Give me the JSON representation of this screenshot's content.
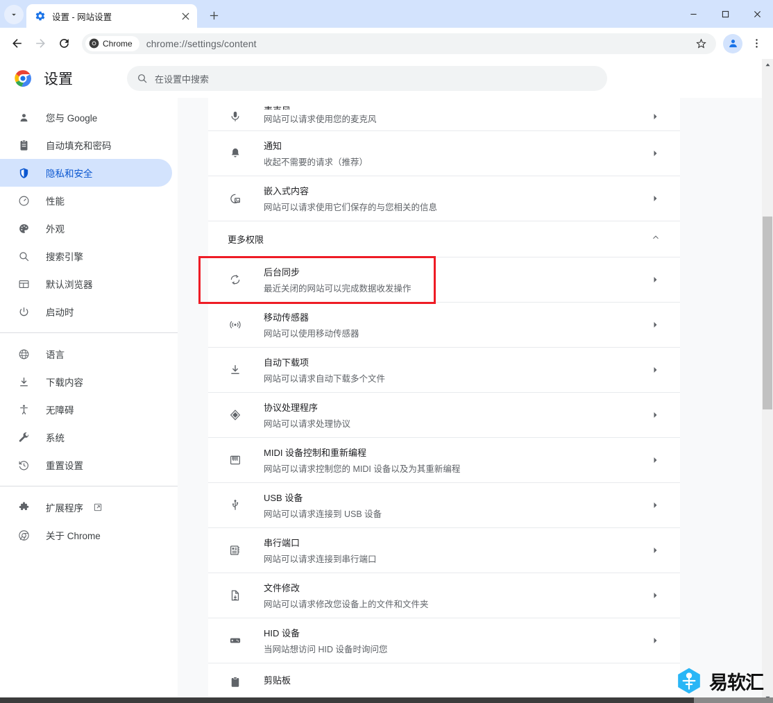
{
  "window": {
    "tab": {
      "title": "设置 - 网站设置",
      "favicon": "gear-icon",
      "close": "×"
    },
    "new_tab": "+",
    "tab_search": "chevron-down-icon",
    "controls": {
      "minimize": "—",
      "maximize": "□",
      "close": "✕"
    }
  },
  "toolbar": {
    "back": "back-arrow-icon",
    "forward": "forward-arrow-icon",
    "reload": "reload-icon",
    "chip_label": "Chrome",
    "url": "chrome://settings/content",
    "bookmark": "star-icon",
    "profile": "avatar-icon",
    "menu": "three-dot-menu-icon"
  },
  "settings": {
    "title": "设置",
    "search_placeholder": "在设置中搜索"
  },
  "sidebar": {
    "groups": [
      {
        "items": [
          {
            "icon": "person-icon",
            "label": "您与 Google",
            "active": false
          },
          {
            "icon": "clipboard-icon",
            "label": "自动填充和密码",
            "active": false
          },
          {
            "icon": "shield-icon",
            "label": "隐私和安全",
            "active": true
          },
          {
            "icon": "gauge-icon",
            "label": "性能",
            "active": false
          },
          {
            "icon": "palette-icon",
            "label": "外观",
            "active": false
          },
          {
            "icon": "search-icon",
            "label": "搜索引擎",
            "active": false
          },
          {
            "icon": "browser-window-icon",
            "label": "默认浏览器",
            "active": false
          },
          {
            "icon": "power-icon",
            "label": "启动时",
            "active": false
          }
        ]
      },
      {
        "items": [
          {
            "icon": "globe-icon",
            "label": "语言",
            "active": false
          },
          {
            "icon": "download-icon",
            "label": "下载内容",
            "active": false
          },
          {
            "icon": "accessibility-icon",
            "label": "无障碍",
            "active": false
          },
          {
            "icon": "wrench-icon",
            "label": "系统",
            "active": false
          },
          {
            "icon": "history-restore-icon",
            "label": "重置设置",
            "active": false
          }
        ]
      },
      {
        "items": [
          {
            "icon": "puzzle-icon",
            "label": "扩展程序",
            "active": false,
            "external": true
          },
          {
            "icon": "chrome-icon",
            "label": "关于 Chrome",
            "active": false
          }
        ]
      }
    ]
  },
  "content": {
    "rows_before_section": [
      {
        "icon": "microphone-icon",
        "title": "麦克风",
        "subtitle": "网站可以请求使用您的麦克风",
        "clipped_top": true
      },
      {
        "icon": "bell-icon",
        "title": "通知",
        "subtitle": "收起不需要的请求（推荐）"
      },
      {
        "icon": "embedded-content-icon",
        "title": "嵌入式内容",
        "subtitle": "网站可以请求使用它们保存的与您相关的信息"
      }
    ],
    "section": {
      "label": "更多权限",
      "expanded": true,
      "collapse_icon": "chevron-up-icon"
    },
    "rows_after_section": [
      {
        "icon": "sync-icon",
        "title": "后台同步",
        "subtitle": "最近关闭的网站可以完成数据收发操作",
        "highlighted": true
      },
      {
        "icon": "motion-sensor-icon",
        "title": "移动传感器",
        "subtitle": "网站可以使用移动传感器"
      },
      {
        "icon": "download-icon",
        "title": "自动下载项",
        "subtitle": "网站可以请求自动下载多个文件"
      },
      {
        "icon": "protocol-handler-icon",
        "title": "协议处理程序",
        "subtitle": "网站可以请求处理协议"
      },
      {
        "icon": "midi-icon",
        "title": "MIDI 设备控制和重新编程",
        "subtitle": "网站可以请求控制您的 MIDI 设备以及为其重新编程"
      },
      {
        "icon": "usb-icon",
        "title": "USB 设备",
        "subtitle": "网站可以请求连接到 USB 设备"
      },
      {
        "icon": "serial-port-icon",
        "title": "串行端口",
        "subtitle": "网站可以请求连接到串行端口"
      },
      {
        "icon": "file-edit-icon",
        "title": "文件修改",
        "subtitle": "网站可以请求修改您设备上的文件和文件夹"
      },
      {
        "icon": "hid-device-icon",
        "title": "HID 设备",
        "subtitle": "当网站想访问 HID 设备时询问您"
      },
      {
        "icon": "clipboard-paste-icon",
        "title": "剪贴板",
        "subtitle": "",
        "clipped_bottom": true
      }
    ],
    "row_arrow": "chevron-right-icon"
  },
  "annotation": {
    "color": "#ee1c25",
    "target": "后台同步"
  },
  "scrollbar": {
    "up": "scroll-up-arrow",
    "down": "scroll-down-arrow"
  },
  "watermark": {
    "text": "易软汇",
    "logo_color": "#29b6f6"
  },
  "colors": {
    "tabstrip": "#d3e3fd",
    "active_nav_bg": "#d3e3fd",
    "active_nav_text": "#0b57d0",
    "annotation": "#ee1c25",
    "page_bg": "#f8f9fa"
  }
}
